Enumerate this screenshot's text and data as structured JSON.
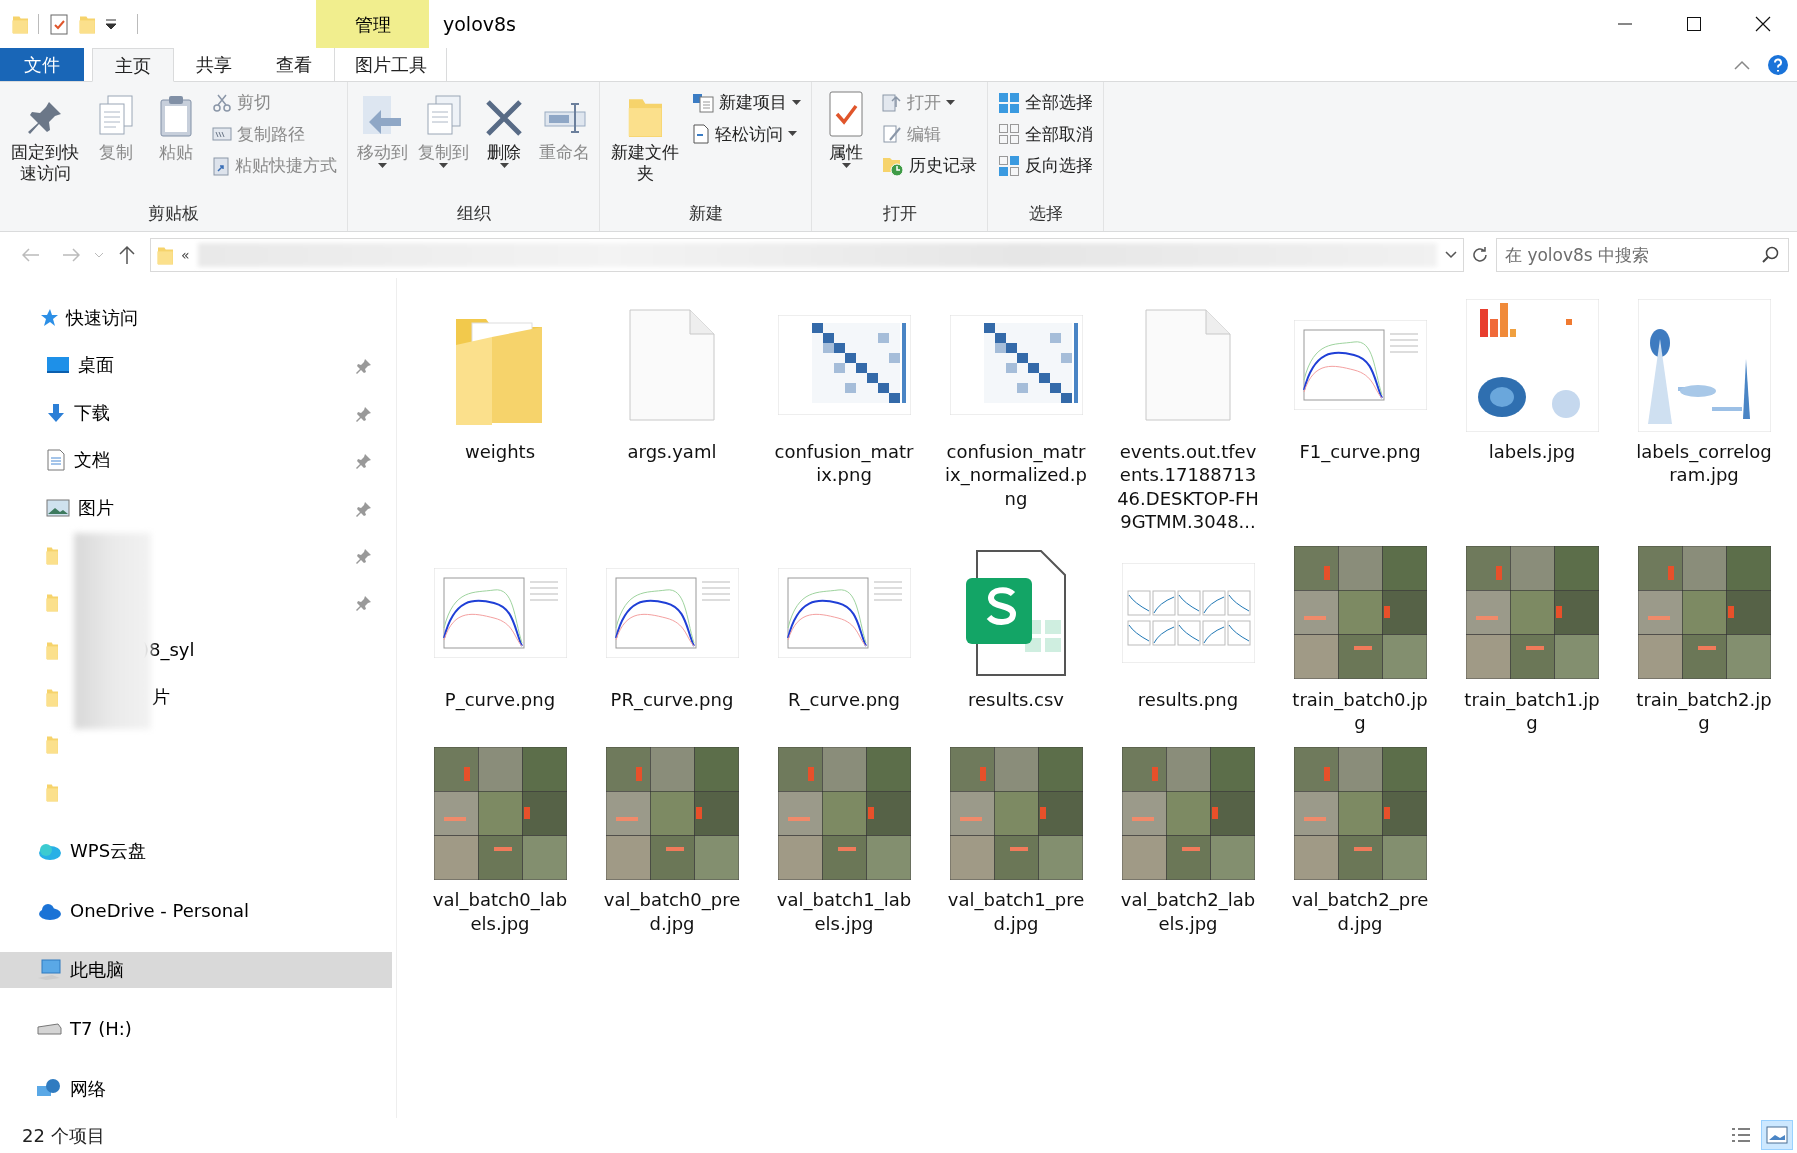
{
  "window": {
    "title": "yolov8s",
    "context_tab": "管理"
  },
  "tabs": [
    {
      "label": "文件",
      "kind": "file",
      "selected": false
    },
    {
      "label": "主页",
      "kind": "tab",
      "selected": true
    },
    {
      "label": "共享",
      "kind": "tab",
      "selected": false
    },
    {
      "label": "查看",
      "kind": "tab",
      "selected": false
    },
    {
      "label": "图片工具",
      "kind": "tab",
      "selected": false
    }
  ],
  "ribbon": {
    "groups": [
      {
        "label": "剪贴板",
        "items": [
          {
            "kind": "large",
            "label": "固定到快速访问",
            "disabled": false,
            "dropdown": false
          },
          {
            "kind": "large",
            "label": "复制",
            "disabled": true,
            "dropdown": false
          },
          {
            "kind": "large",
            "label": "粘贴",
            "disabled": true,
            "dropdown": false
          },
          {
            "kind": "stack",
            "items": [
              {
                "label": "剪切",
                "disabled": true,
                "dropdown": false
              },
              {
                "label": "复制路径",
                "disabled": true,
                "dropdown": false
              },
              {
                "label": "粘贴快捷方式",
                "disabled": true,
                "dropdown": false
              }
            ]
          }
        ]
      },
      {
        "label": "组织",
        "items": [
          {
            "kind": "large",
            "label": "移动到",
            "disabled": true,
            "dropdown": true
          },
          {
            "kind": "large",
            "label": "复制到",
            "disabled": true,
            "dropdown": true
          },
          {
            "kind": "large",
            "label": "删除",
            "disabled": false,
            "dropdown": true
          },
          {
            "kind": "large",
            "label": "重命名",
            "disabled": true,
            "dropdown": false
          }
        ]
      },
      {
        "label": "新建",
        "items": [
          {
            "kind": "large",
            "label": "新建文件夹",
            "disabled": false,
            "dropdown": false
          },
          {
            "kind": "stack",
            "items": [
              {
                "label": "新建项目",
                "disabled": false,
                "dropdown": true
              },
              {
                "label": "轻松访问",
                "disabled": false,
                "dropdown": true
              }
            ]
          }
        ]
      },
      {
        "label": "打开",
        "items": [
          {
            "kind": "large",
            "label": "属性",
            "disabled": false,
            "dropdown": true
          },
          {
            "kind": "stack",
            "items": [
              {
                "label": "打开",
                "disabled": true,
                "dropdown": true
              },
              {
                "label": "编辑",
                "disabled": true,
                "dropdown": false
              },
              {
                "label": "历史记录",
                "disabled": false,
                "dropdown": false
              }
            ]
          }
        ]
      },
      {
        "label": "选择",
        "items": [
          {
            "kind": "stack",
            "items": [
              {
                "label": "全部选择",
                "disabled": false,
                "dropdown": false
              },
              {
                "label": "全部取消",
                "disabled": false,
                "dropdown": false
              },
              {
                "label": "反向选择",
                "disabled": false,
                "dropdown": false
              }
            ]
          }
        ]
      }
    ]
  },
  "address_bar": {
    "path": "«"
  },
  "search": {
    "placeholder": "在 yolov8s 中搜索"
  },
  "sidebar": {
    "items": [
      {
        "label": "快速访问",
        "kind": "quick",
        "selected": false,
        "children": [
          {
            "label": "桌面",
            "kind": "desktop",
            "pinned": true,
            "selected": false
          },
          {
            "label": "下载",
            "kind": "download",
            "pinned": true,
            "selected": false
          },
          {
            "label": "文档",
            "kind": "document",
            "pinned": true,
            "selected": false
          },
          {
            "label": "图片",
            "kind": "pictures",
            "pinned": true,
            "selected": false
          },
          {
            "kind": "folder",
            "pinned": true,
            "selected": false
          },
          {
            "kind": "folder",
            "pinned": true,
            "selected": false
          },
          {
            "label": ")8_syl",
            "kind": "folder",
            "pinned": false,
            "selected": false
          },
          {
            "label": "片",
            "kind": "folder",
            "pinned": false,
            "selected": false
          },
          {
            "kind": "folder",
            "pinned": false,
            "selected": false
          },
          {
            "kind": "folder",
            "pinned": false,
            "selected": false
          }
        ]
      },
      {
        "label": "WPS云盘",
        "kind": "wps",
        "selected": false
      },
      {
        "label": "OneDrive - Personal",
        "kind": "onedrive",
        "selected": false
      },
      {
        "label": "此电脑",
        "kind": "pc",
        "selected": true
      },
      {
        "label": "T7 (H:)",
        "kind": "drive",
        "selected": false
      },
      {
        "label": "网络",
        "kind": "network",
        "selected": false
      }
    ]
  },
  "files": [
    {
      "name": "weights",
      "kind": "folder"
    },
    {
      "name": "args.yaml",
      "kind": "file"
    },
    {
      "name": "confusion_matrix.png",
      "kind": "heatmap"
    },
    {
      "name": "confusion_matrix_normalized.png",
      "kind": "heatmap"
    },
    {
      "name": "events.out.tfevents.1718871346.DESKTOP-FH9GTMM.3048...",
      "kind": "file"
    },
    {
      "name": "F1_curve.png",
      "kind": "curve"
    },
    {
      "name": "labels.jpg",
      "kind": "labels"
    },
    {
      "name": "labels_correlogram.jpg",
      "kind": "correlogram"
    },
    {
      "name": "P_curve.png",
      "kind": "curve"
    },
    {
      "name": "PR_curve.png",
      "kind": "curve"
    },
    {
      "name": "R_curve.png",
      "kind": "curve"
    },
    {
      "name": "results.csv",
      "kind": "spreadsheet"
    },
    {
      "name": "results.png",
      "kind": "results"
    },
    {
      "name": "train_batch0.jpg"
    },
    {
      "name": "train_batch1.jpg"
    },
    {
      "name": "train_batch2.jpg"
    },
    {
      "name": "val_batch0_labels.jpg"
    },
    {
      "name": "val_batch0_pred.jpg"
    },
    {
      "name": "val_batch1_labels.jpg"
    },
    {
      "name": "val_batch1_pred.jpg"
    },
    {
      "name": "val_batch2_labels.jpg"
    },
    {
      "name": "val_batch2_pred.jpg"
    }
  ],
  "status_bar": {
    "count": "22 个项目"
  }
}
